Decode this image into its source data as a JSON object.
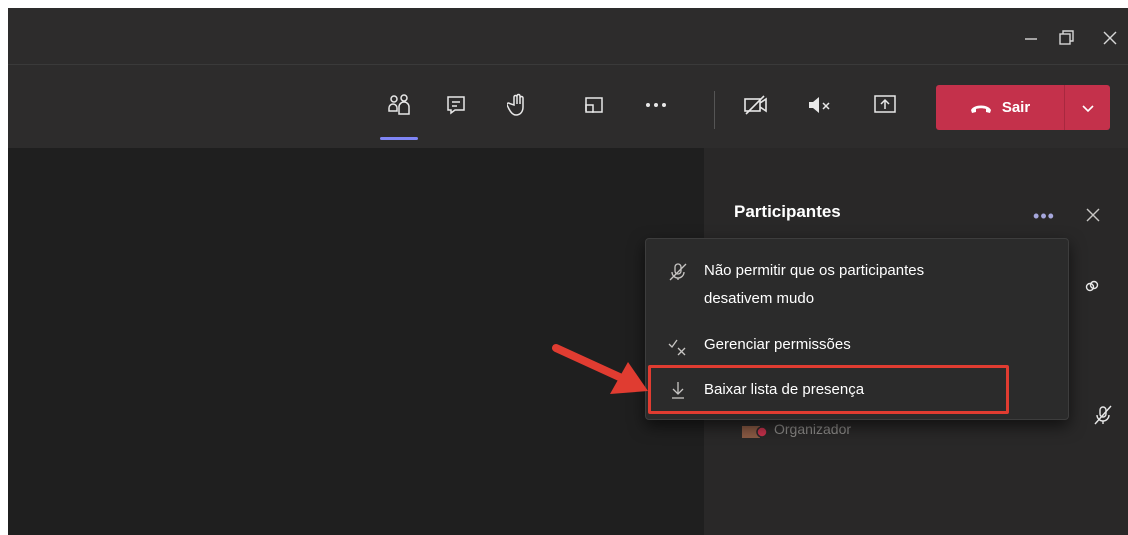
{
  "window": {
    "controls": [
      {
        "name": "minimize-icon"
      },
      {
        "name": "maximize-icon"
      },
      {
        "name": "close-icon"
      }
    ]
  },
  "toolbar": {
    "icons": [
      "people-icon",
      "chat-icon",
      "raise-hand-icon",
      "rooms-icon",
      "more-options-icon",
      "camera-off-icon",
      "speaker-mute-icon",
      "share-screen-icon"
    ],
    "leave_label": "Sair",
    "leave_color": "#c4314b",
    "active_indicator_color": "#7f85f5"
  },
  "panel": {
    "title": "Participantes",
    "more_label": "•••",
    "organizer_label": "Organizador"
  },
  "menu": {
    "items": [
      {
        "label_line1": "Não permitir que os participantes",
        "label_line2": "desativem mudo",
        "icon": "mic-off-icon"
      },
      {
        "label": "Gerenciar permissões",
        "icon": "check-x-icon"
      },
      {
        "label": "Baixar lista de presença",
        "icon": "download-icon"
      }
    ]
  },
  "annotation": {
    "highlight_color": "#e03c31"
  }
}
